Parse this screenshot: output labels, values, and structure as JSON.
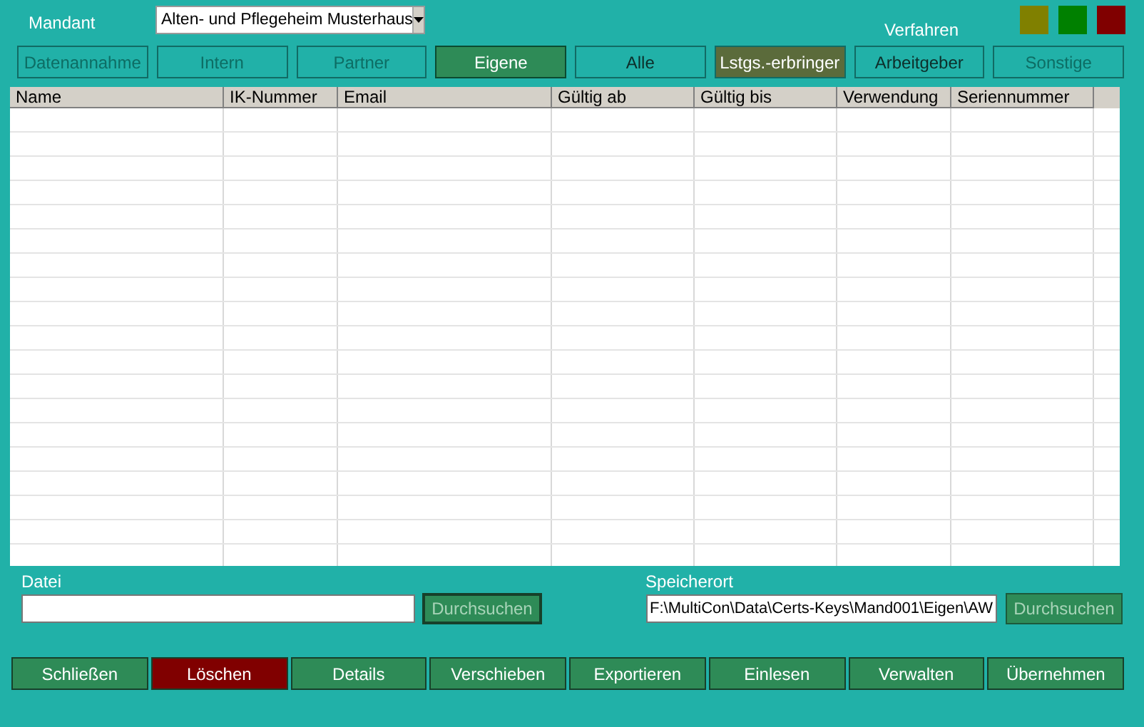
{
  "mandant": {
    "label": "Mandant",
    "value": "Alten- und Pflegeheim Musterhaus"
  },
  "verfahren": {
    "label": "Verfahren",
    "indicators": [
      {
        "color": "#808000"
      },
      {
        "color": "#008000"
      },
      {
        "color": "#800000"
      }
    ]
  },
  "tabs": [
    {
      "label": "Datenannahme",
      "selected": false,
      "disabled": true,
      "marked": false
    },
    {
      "label": "Intern",
      "selected": false,
      "disabled": true,
      "marked": false
    },
    {
      "label": "Partner",
      "selected": false,
      "disabled": true,
      "marked": false
    },
    {
      "label": "Eigene",
      "selected": true,
      "disabled": false,
      "marked": false
    },
    {
      "label": "Alle",
      "selected": false,
      "disabled": false,
      "marked": false
    },
    {
      "label": "Lstgs.-erbringer",
      "selected": false,
      "disabled": false,
      "marked": true
    },
    {
      "label": "Arbeitgeber",
      "selected": false,
      "disabled": false,
      "marked": false
    },
    {
      "label": "Sonstige",
      "selected": false,
      "disabled": true,
      "marked": false
    }
  ],
  "table": {
    "columns": [
      "Name",
      "IK-Nummer",
      "Email",
      "Gültig ab",
      "Gültig bis",
      "Verwendung",
      "Seriennummer"
    ]
  },
  "datei": {
    "label": "Datei",
    "button": {
      "label": "Durchsuchen",
      "disabled": true
    }
  },
  "speicherort": {
    "label": "Speicherort",
    "value": "F:\\MultiCon\\Data\\Certs-Keys\\Mand001\\Eigen\\AW",
    "button": {
      "label": "Durchsuchen",
      "disabled": true
    }
  },
  "buttons": [
    {
      "label": "Schließen",
      "kind": "normal"
    },
    {
      "label": "Löschen",
      "kind": "danger"
    },
    {
      "label": "Details",
      "kind": "normal"
    },
    {
      "label": "Verschieben",
      "kind": "normal"
    },
    {
      "label": "Exportieren",
      "kind": "normal"
    },
    {
      "label": "Einlesen",
      "kind": "normal"
    },
    {
      "label": "Verwalten",
      "kind": "normal"
    },
    {
      "label": "Übernehmen",
      "kind": "normal"
    }
  ]
}
